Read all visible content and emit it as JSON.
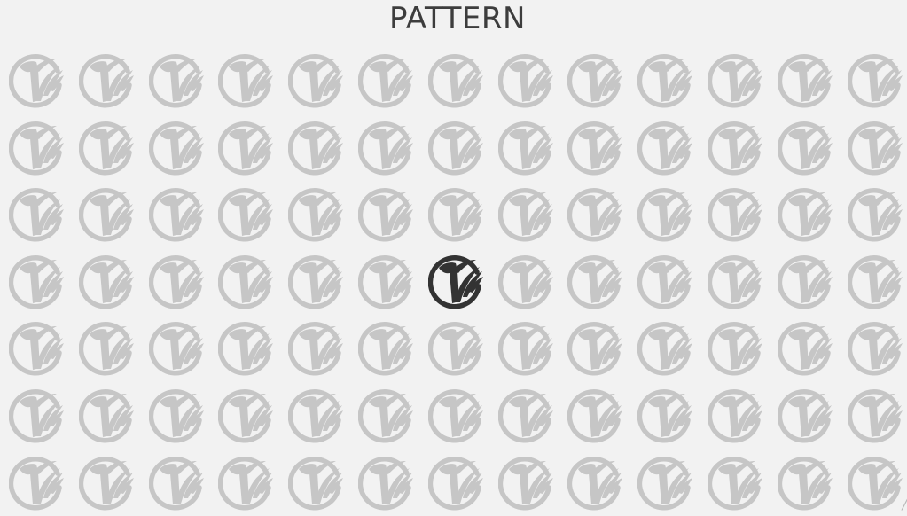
{
  "page": {
    "title": "PATTERN"
  },
  "pattern": {
    "columns": 13,
    "rows": 7,
    "highlight": {
      "row": 4,
      "column": 7
    },
    "colors": {
      "background": "#f2f2f2",
      "logo_default": "#c6c6c6",
      "logo_highlight": "#333333",
      "title": "#3d3d3d"
    },
    "icon": "circle-winged-logo-icon"
  }
}
